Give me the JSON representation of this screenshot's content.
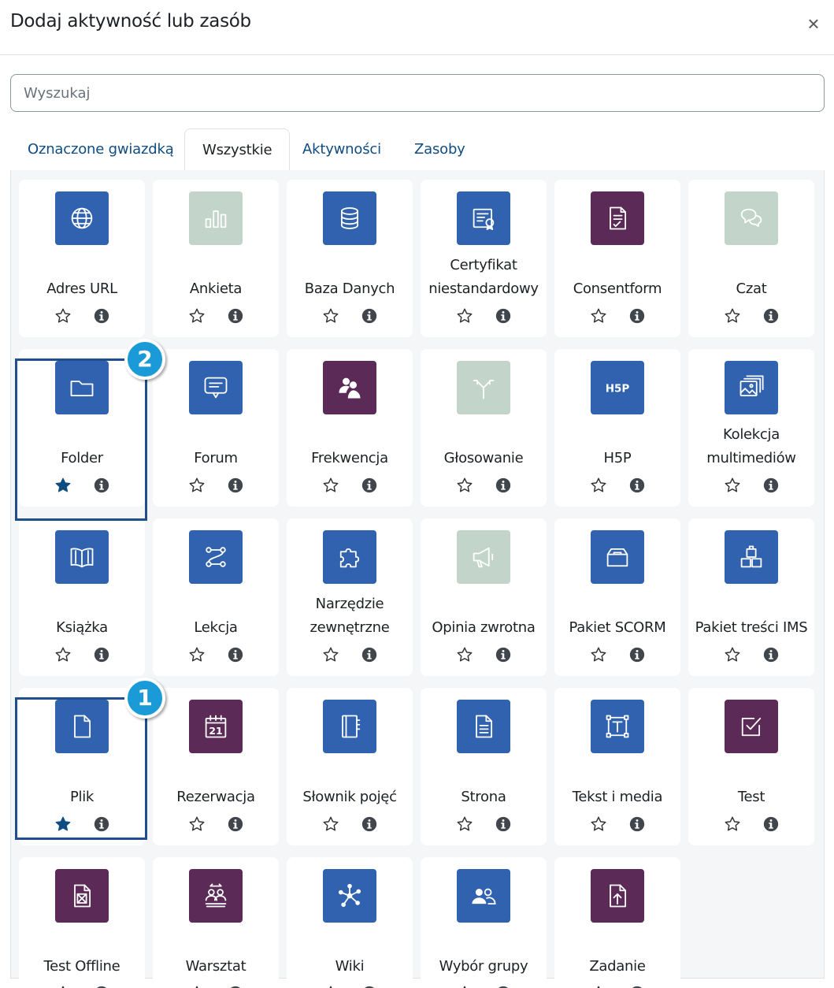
{
  "modal": {
    "title": "Dodaj aktywność lub zasób",
    "close_icon": "×"
  },
  "search": {
    "placeholder": "Wyszukaj",
    "value": ""
  },
  "tabs": [
    {
      "label": "Oznaczone gwiazdką",
      "active": false
    },
    {
      "label": "Wszystkie",
      "active": true
    },
    {
      "label": "Aktywności",
      "active": false
    },
    {
      "label": "Zasoby",
      "active": false
    }
  ],
  "colors": {
    "blue": "#3062b0",
    "purple": "#5b2a56",
    "gray": "#c3d5cb",
    "highlight": "#1f4f8f",
    "badge": "#1a9ad6",
    "star_filled": "#0f4c81"
  },
  "items": [
    {
      "name": "Adres URL",
      "icon": "globe-icon",
      "color": "blue",
      "starred": false
    },
    {
      "name": "Ankieta",
      "icon": "bar-chart-icon",
      "color": "gray",
      "starred": false
    },
    {
      "name": "Baza Danych",
      "icon": "database-icon",
      "color": "blue",
      "starred": false
    },
    {
      "name": "Certyfikat niestandardowy",
      "icon": "certificate-icon",
      "color": "blue",
      "starred": false
    },
    {
      "name": "Consentform",
      "icon": "consent-document-icon",
      "color": "purple",
      "starred": false
    },
    {
      "name": "Czat",
      "icon": "chat-bubbles-icon",
      "color": "gray",
      "starred": false
    },
    {
      "name": "Folder",
      "icon": "folder-icon",
      "color": "blue",
      "starred": true,
      "badge": "2"
    },
    {
      "name": "Forum",
      "icon": "message-icon",
      "color": "blue",
      "starred": false
    },
    {
      "name": "Frekwencja",
      "icon": "attendance-icon",
      "color": "purple",
      "starred": false
    },
    {
      "name": "Głosowanie",
      "icon": "split-arrows-icon",
      "color": "gray",
      "starred": false
    },
    {
      "name": "H5P",
      "icon": "h5p-icon",
      "color": "blue",
      "starred": false
    },
    {
      "name": "Kolekcja multimediów",
      "icon": "image-collection-icon",
      "color": "blue",
      "starred": false
    },
    {
      "name": "Książka",
      "icon": "book-icon",
      "color": "blue",
      "starred": false
    },
    {
      "name": "Lekcja",
      "icon": "lesson-path-icon",
      "color": "blue",
      "starred": false
    },
    {
      "name": "Narzędzie zewnętrzne",
      "icon": "puzzle-icon",
      "color": "blue",
      "starred": false
    },
    {
      "name": "Opinia zwrotna",
      "icon": "megaphone-icon",
      "color": "gray",
      "starred": false
    },
    {
      "name": "Pakiet SCORM",
      "icon": "package-box-icon",
      "color": "blue",
      "starred": false
    },
    {
      "name": "Pakiet treści IMS",
      "icon": "stacked-boxes-icon",
      "color": "blue",
      "starred": false
    },
    {
      "name": "Plik",
      "icon": "file-icon",
      "color": "blue",
      "starred": true,
      "badge": "1"
    },
    {
      "name": "Rezerwacja",
      "icon": "calendar-icon",
      "color": "purple",
      "starred": false,
      "icon_text": "21"
    },
    {
      "name": "Słownik pojęć",
      "icon": "glossary-book-icon",
      "color": "blue",
      "starred": false
    },
    {
      "name": "Strona",
      "icon": "page-document-icon",
      "color": "blue",
      "starred": false
    },
    {
      "name": "Tekst i media",
      "icon": "text-media-icon",
      "color": "blue",
      "starred": false
    },
    {
      "name": "Test",
      "icon": "checkbox-icon",
      "color": "purple",
      "starred": false
    },
    {
      "name": "Test Offline",
      "icon": "offline-quiz-icon",
      "color": "purple",
      "starred": false
    },
    {
      "name": "Warsztat",
      "icon": "workshop-people-icon",
      "color": "purple",
      "starred": false
    },
    {
      "name": "Wiki",
      "icon": "wiki-network-icon",
      "color": "blue",
      "starred": false
    },
    {
      "name": "Wybór grupy",
      "icon": "group-people-icon",
      "color": "blue",
      "starred": false
    },
    {
      "name": "Zadanie",
      "icon": "assignment-upload-icon",
      "color": "purple",
      "starred": false
    }
  ]
}
